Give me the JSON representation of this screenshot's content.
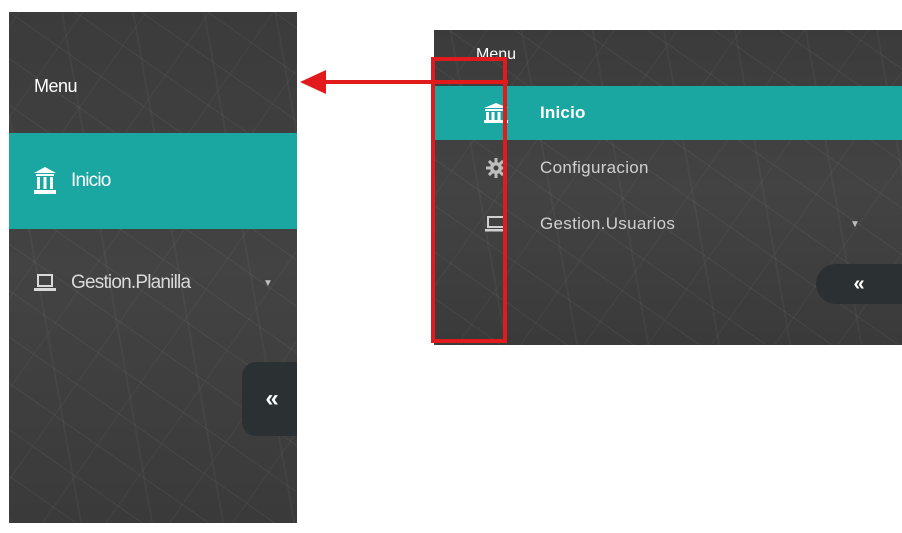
{
  "left_panel": {
    "title": "Menu",
    "items": [
      {
        "label": "Inicio",
        "icon": "bank-icon",
        "active": true
      },
      {
        "label": "Gestion.Planilla",
        "icon": "laptop-icon",
        "active": false,
        "has_dropdown": true
      }
    ],
    "dropdown_caret": "▼",
    "collapse_label": "«"
  },
  "right_panel": {
    "title": "Menu",
    "items": [
      {
        "label": "Inicio",
        "icon": "bank-icon",
        "active": true
      },
      {
        "label": "Configuracion",
        "icon": "gear-icon",
        "active": false
      },
      {
        "label": "Gestion.Usuarios",
        "icon": "laptop-icon",
        "active": false,
        "has_dropdown": true
      }
    ],
    "dropdown_caret": "▼",
    "collapse_label": "«"
  },
  "colors": {
    "active_bg": "#1aa7a1",
    "panel_bg": "#3f3f3f",
    "annotation": "#e11b1b",
    "collapse_bg": "#2b3032"
  }
}
